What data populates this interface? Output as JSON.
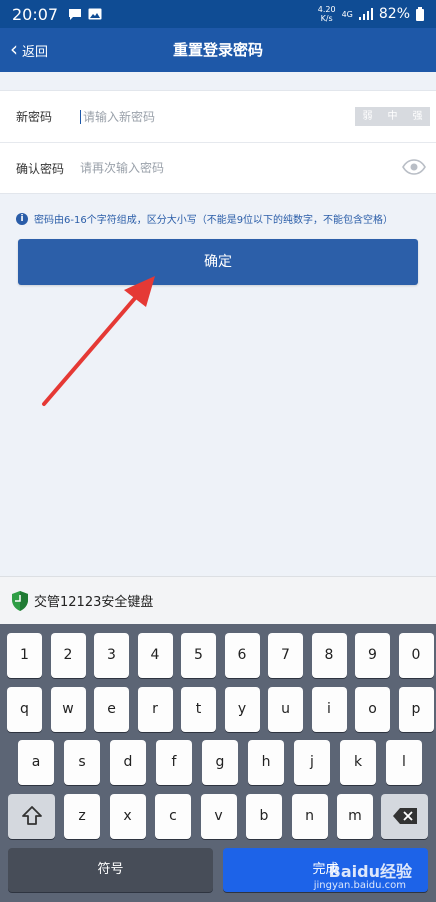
{
  "status": {
    "time": "20:07",
    "net_speed_top": "4.20",
    "net_speed_bottom": "K/s",
    "net_type": "4G",
    "battery": "82%"
  },
  "nav": {
    "back_label": "返回",
    "title": "重置登录密码"
  },
  "form": {
    "new_password": {
      "label": "新密码",
      "placeholder": "请输入新密码",
      "strength": [
        "弱",
        "中",
        "强"
      ]
    },
    "confirm_password": {
      "label": "确认密码",
      "placeholder": "请再次输入密码"
    }
  },
  "hint": "密码由6-16个字符组成，区分大小写（不能是9位以下的纯数字，不能包含空格）",
  "confirm_button": "确定",
  "keyboard": {
    "title": "交管12123安全键盘",
    "row1": [
      "1",
      "2",
      "3",
      "4",
      "5",
      "6",
      "7",
      "8",
      "9",
      "0"
    ],
    "row2": [
      "q",
      "w",
      "e",
      "r",
      "t",
      "y",
      "u",
      "i",
      "o",
      "p"
    ],
    "row3": [
      "a",
      "s",
      "d",
      "f",
      "g",
      "h",
      "j",
      "k",
      "l"
    ],
    "row4": [
      "z",
      "x",
      "c",
      "v",
      "b",
      "n",
      "m"
    ],
    "symbol_label": "符号",
    "done_label": "完成"
  },
  "watermark": {
    "main": "Baidu经验",
    "sub": "jingyan.baidu.com"
  },
  "colors": {
    "nav": "#1e58a8",
    "accent": "#2c5fa9",
    "arrow": "#e53935",
    "done_key": "#1d63e8"
  }
}
